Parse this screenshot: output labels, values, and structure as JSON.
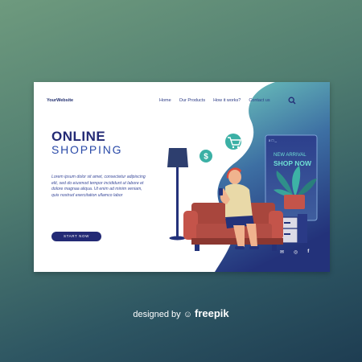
{
  "site": {
    "logo": "YourWebsite"
  },
  "nav": {
    "items": [
      "Home",
      "Our Products",
      "How it works?",
      "Contact us"
    ]
  },
  "hero": {
    "title_line1": "ONLINE",
    "title_line2": "SHOPPING",
    "paragraph": "Lorem ipsum dolor sit amet, consectetur adipiscing elit, sed do eiusmod tempor incididunt ut labore et dolore magnaa aliqua. Ut enim ad minim veniam, quis nostrud exercitation ullamco labor",
    "button": "START NOW"
  },
  "screen": {
    "window_controls": "x □ _",
    "banner_line1": "NEW ARRIVAL",
    "banner_line2": "SHOP NOW"
  },
  "icons": {
    "money": "dollar-sign",
    "cart": "shopping-cart",
    "search": "magnifier",
    "mail": "envelope",
    "instagram": "instagram",
    "facebook": "facebook"
  },
  "footer": {
    "prefix": "designed by",
    "brand": "freepik"
  },
  "colors": {
    "primary": "#232a75",
    "accent": "#2a4aa8",
    "teal": "#3bb0a5"
  }
}
